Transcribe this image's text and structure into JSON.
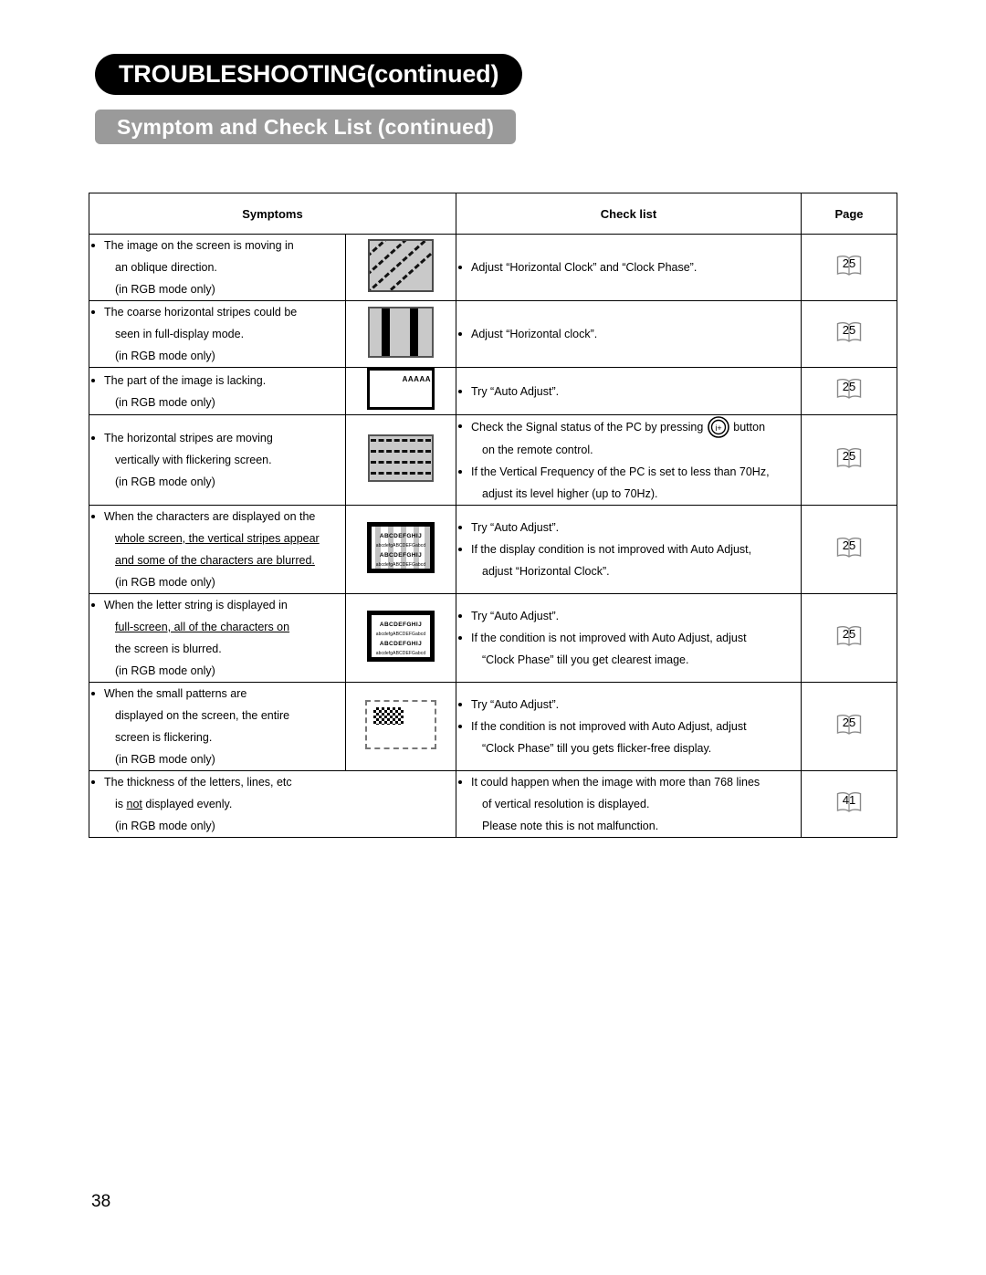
{
  "header": {
    "chapter_title": "TROUBLESHOOTING(continued)",
    "section_title": "Symptom and Check List (continued)"
  },
  "table": {
    "columns": [
      "Symptoms",
      "",
      "Check list",
      "Page"
    ],
    "rows": [
      {
        "symptom_lines": [
          "The image on the screen is moving in",
          "an oblique direction.",
          "(in RGB mode only)"
        ],
        "thumb": "oblique-dashed-stripes-thumbnail",
        "check_lines": [
          "Adjust “Horizontal Clock” and “Clock Phase”."
        ],
        "page": "25"
      },
      {
        "symptom_lines": [
          "The coarse horizontal stripes could be",
          "seen in full-display mode.",
          "(in RGB mode only)"
        ],
        "thumb": "coarse-vertical-stripes-thumbnail",
        "check_lines": [
          "Adjust “Horizontal clock”."
        ],
        "page": "25"
      },
      {
        "symptom_lines": [
          "The part of the image is lacking.",
          "(in RGB mode only)"
        ],
        "thumb": "partial-image-thumbnail",
        "thumb_text": "AAAAA",
        "check_lines": [
          "Try “Auto Adjust”."
        ],
        "page": "25"
      },
      {
        "symptom_lines": [
          "The horizontal stripes are moving",
          "vertically with flickering screen.",
          "(in RGB mode only)"
        ],
        "thumb": "dashed-horizontal-stripes-thumbnail",
        "check_lines_rich": [
          {
            "a": "Check the Signal status of the PC by pressing",
            "icon": "info-button-icon",
            "b": "button"
          },
          {
            "cont": "on the remote control."
          },
          {
            "a": "If the Vertical Frequency of the PC is set to less than 70Hz,"
          },
          {
            "cont": "adjust its level higher (up to 70Hz)."
          }
        ],
        "page": "25"
      },
      {
        "symptom_lines": [
          "When the characters are displayed on the",
          "whole screen, the vertical stripes appear",
          "and some of the characters are blurred.",
          "(in RGB mode only)"
        ],
        "thumb": "striped-characters-thumbnail",
        "thumb_text": {
          "l1": "ABCDEFGHIJ",
          "l2": "abcdefgABCDEFGabcd"
        },
        "check_lines": [
          "Try “Auto Adjust”.",
          "If the display condition is not improved with Auto Adjust,",
          "adjust “Horizontal Clock”."
        ],
        "page": "25"
      },
      {
        "symptom_lines": [
          "When the letter string is displayed in",
          "full-screen, all of the characters on",
          "the screen is blurred.",
          "(in RGB mode only)"
        ],
        "thumb": "blurred-characters-thumbnail",
        "thumb_text": {
          "l1": "ABCDEFGHIJ",
          "l2": "abcdefgABCDEFGabcd"
        },
        "check_lines": [
          "Try “Auto Adjust”.",
          "If the condition is not improved with Auto Adjust, adjust",
          "“Clock Phase” till you get clearest image."
        ],
        "page": "25"
      },
      {
        "symptom_lines": [
          "When the small patterns are",
          "displayed on the screen, the entire",
          "screen is flickering.",
          "(in RGB mode only)"
        ],
        "thumb": "checkerboard-pattern-thumbnail",
        "check_lines": [
          "Try “Auto Adjust”.",
          "If the condition is not improved with Auto Adjust, adjust",
          "“Clock Phase” till you gets flicker-free display."
        ],
        "page": "25"
      },
      {
        "symptom_lines": [
          "The thickness of the letters, lines, etc",
          "is not displayed evenly.",
          "(in RGB mode only)"
        ],
        "thumb": null,
        "check_lines": [
          "It could happen when the image with more than 768 lines",
          "of vertical resolution is displayed.",
          "Please note this is not malfunction."
        ],
        "page": "41"
      }
    ]
  },
  "footer": {
    "page_number": "38"
  },
  "colors": {
    "chapter_tab_bg": "#000000",
    "section_tab_bg": "#9a9a9a",
    "text": "#000000",
    "thumb_gray": "#c9c9c9"
  }
}
